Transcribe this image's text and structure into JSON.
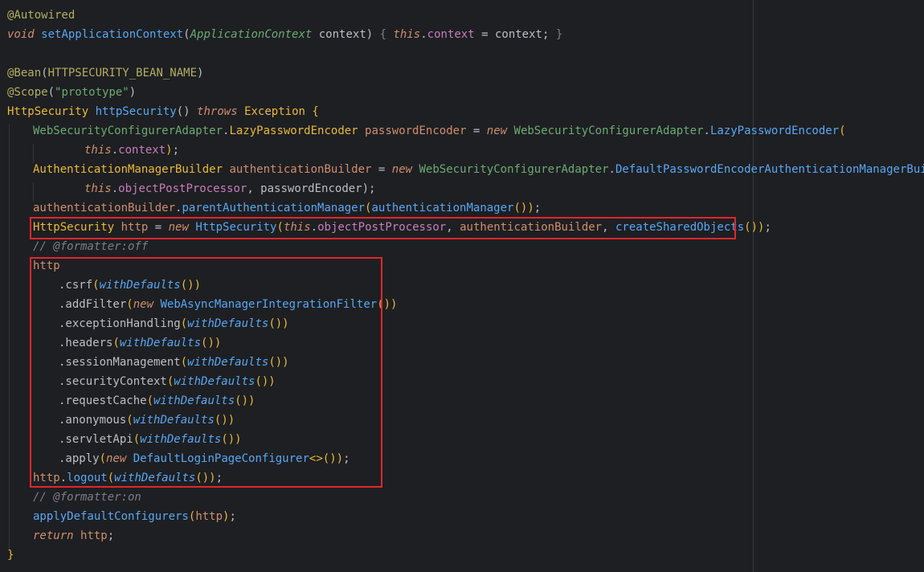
{
  "code": {
    "l1": "@Autowired",
    "l2_kw": "void",
    "l2_name": "setApplicationContext",
    "l2_type": "ApplicationContext",
    "l2_rest_a": " context) ",
    "l2_body_this": "this",
    "l2_body_field": "context",
    "l2_body_rest": " = context; ",
    "l3": "",
    "l4_ann": "@Bean",
    "l4_arg": "HTTPSECURITY_BEAN_NAME",
    "l5_ann": "@Scope",
    "l5_str": "\"prototype\"",
    "l6_type": "HttpSecurity",
    "l6_name": "httpSecurity",
    "l6_throws": "throws",
    "l6_exc": "Exception",
    "l7_cls": "WebSecurityConfigurerAdapter",
    "l7_inner": "LazyPasswordEncoder",
    "l7_var": "passwordEncoder",
    "l7_new": "new",
    "l7_cls2": "WebSecurityConfigurerAdapter",
    "l7_inner2": "LazyPasswordEncoder",
    "l8_this": "this",
    "l8_field": "context",
    "l9_type": "AuthenticationManagerBuilder",
    "l9_var": "authenticationBuilder",
    "l9_new": "new",
    "l9_cls": "WebSecurityConfigurerAdapter",
    "l9_inner": "DefaultPasswordEncoderAuthenticationManagerBuilder",
    "l10_this": "this",
    "l10_field": "objectPostProcessor",
    "l10_rest": ", passwordEncoder);",
    "l11_var": "authenticationBuilder",
    "l11_mth": "parentAuthenticationManager",
    "l11_arg": "authenticationManager",
    "l12_type": "HttpSecurity",
    "l12_var": "http",
    "l12_new": "new",
    "l12_cls": "HttpSecurity",
    "l12_this": "this",
    "l12_field": "objectPostProcessor",
    "l12_arg2": "authenticationBuilder",
    "l12_mth": "createSharedObjects",
    "l13": "// @formatter:off",
    "l14": "http",
    "chain": [
      {
        "m": ".csrf",
        "arg": "withDefaults",
        "new": "",
        "tail": ")"
      },
      {
        "m": ".addFilter",
        "arg": "",
        "new": "new",
        "cls": "WebAsyncManagerIntegrationFilter",
        "tail": ")"
      },
      {
        "m": ".exceptionHandling",
        "arg": "withDefaults",
        "tail": ")"
      },
      {
        "m": ".headers",
        "arg": "withDefaults",
        "tail": ")"
      },
      {
        "m": ".sessionManagement",
        "arg": "withDefaults",
        "tail": ")"
      },
      {
        "m": ".securityContext",
        "arg": "withDefaults",
        "tail": ")"
      },
      {
        "m": ".requestCache",
        "arg": "withDefaults",
        "tail": ")"
      },
      {
        "m": ".anonymous",
        "arg": "withDefaults",
        "tail": ")"
      },
      {
        "m": ".servletApi",
        "arg": "withDefaults",
        "tail": ")"
      }
    ],
    "l24_m": ".apply",
    "l24_new": "new",
    "l24_cls": "DefaultLoginPageConfigurer",
    "l25_var": "http",
    "l25_m": "logout",
    "l25_arg": "withDefaults",
    "l26": "// @formatter:on",
    "l27_mth": "applyDefaultConfigurers",
    "l27_arg": "http",
    "l28_kw": "return",
    "l28_var": "http",
    "l29": "}"
  },
  "colors": {
    "background": "#1e1f22",
    "keyword": "#cf8e6d",
    "annotation": "#b3ae60",
    "string": "#6aab73",
    "method": "#56a8f5",
    "field": "#c77dbb",
    "comment": "#7a7e85",
    "highlight": "#e0262d"
  }
}
